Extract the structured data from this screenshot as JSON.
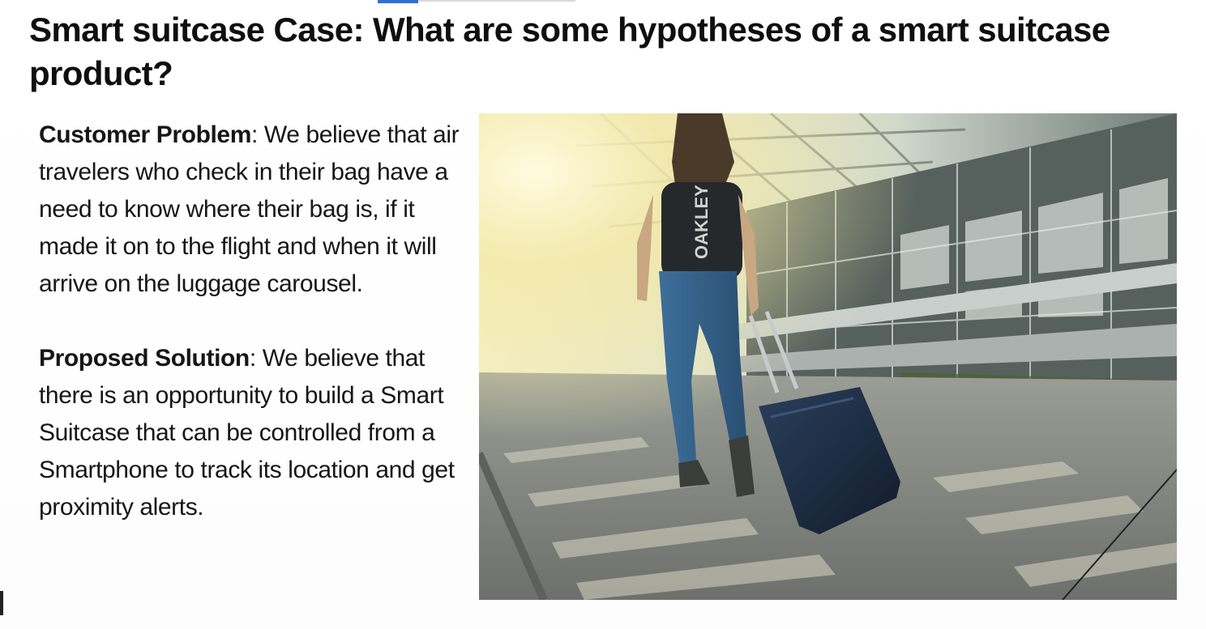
{
  "slide": {
    "title": "Smart suitcase Case: What are some hypotheses of a smart suitcase product?",
    "problem": {
      "label": "Customer Problem",
      "text": ": We believe that air travelers who check in their bag have a need to know where their bag is, if it made it on to the flight and when it will arrive on the luggage carousel."
    },
    "solution": {
      "label": "Proposed Solution",
      "text": ": We believe that there is an opportunity to build a Smart Suitcase that can be controlled from a Smartphone to track its location and get proximity alerts."
    },
    "photo": {
      "subject": "traveler-pulling-suitcase-at-airport",
      "backpack_logo": "OAKLEY"
    }
  }
}
